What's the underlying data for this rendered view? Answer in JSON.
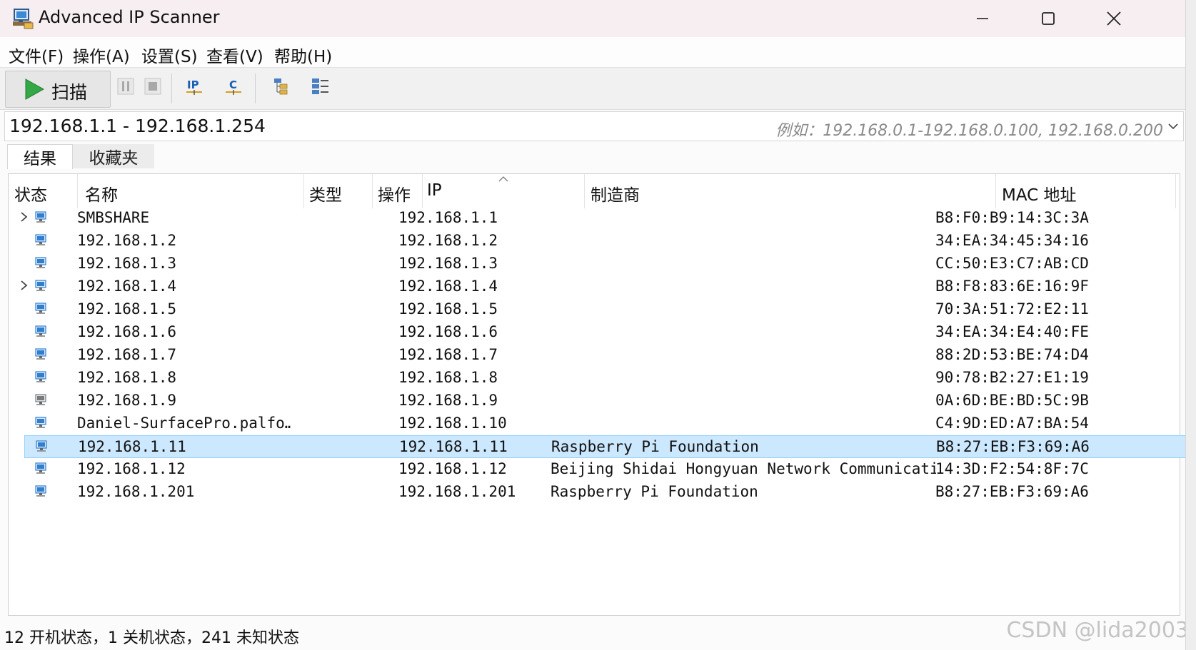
{
  "window": {
    "title": "Advanced IP Scanner",
    "minimize_label": "minimize",
    "maximize_label": "maximize",
    "close_label": "close"
  },
  "menu": [
    "文件(F)",
    "操作(A)",
    "设置(S)",
    "查看(V)",
    "帮助(H)"
  ],
  "toolbar": {
    "scan_label": "扫描",
    "icons": [
      "pause-icon",
      "stop-icon",
      "ip-icon",
      "c-class-icon",
      "expand-all-icon",
      "collapse-all-icon"
    ]
  },
  "range": {
    "value": "192.168.1.1 - 192.168.1.254",
    "placeholder": "例如：192.168.0.1-192.168.0.100, 192.168.0.200"
  },
  "tabs": [
    {
      "label": "结果",
      "active": true
    },
    {
      "label": "收藏夹",
      "active": false
    }
  ],
  "columns": {
    "status": "状态",
    "name": "名称",
    "type": "类型",
    "ops": "操作",
    "ip": "IP",
    "vendor": "制造商",
    "mac": "MAC 地址"
  },
  "rows": [
    {
      "name": "SMBSHARE",
      "ip": "192.168.1.1",
      "vendor": "",
      "mac": "B8:F0:B9:14:3C:3A",
      "expandable": true,
      "selected": false,
      "state": "on"
    },
    {
      "name": "192.168.1.2",
      "ip": "192.168.1.2",
      "vendor": "",
      "mac": "34:EA:34:45:34:16",
      "expandable": false,
      "selected": false,
      "state": "on"
    },
    {
      "name": "192.168.1.3",
      "ip": "192.168.1.3",
      "vendor": "",
      "mac": "CC:50:E3:C7:AB:CD",
      "expandable": false,
      "selected": false,
      "state": "on"
    },
    {
      "name": "192.168.1.4",
      "ip": "192.168.1.4",
      "vendor": "",
      "mac": "B8:F8:83:6E:16:9F",
      "expandable": true,
      "selected": false,
      "state": "on"
    },
    {
      "name": "192.168.1.5",
      "ip": "192.168.1.5",
      "vendor": "",
      "mac": "70:3A:51:72:E2:11",
      "expandable": false,
      "selected": false,
      "state": "on"
    },
    {
      "name": "192.168.1.6",
      "ip": "192.168.1.6",
      "vendor": "",
      "mac": "34:EA:34:E4:40:FE",
      "expandable": false,
      "selected": false,
      "state": "on"
    },
    {
      "name": "192.168.1.7",
      "ip": "192.168.1.7",
      "vendor": "",
      "mac": "88:2D:53:BE:74:D4",
      "expandable": false,
      "selected": false,
      "state": "on"
    },
    {
      "name": "192.168.1.8",
      "ip": "192.168.1.8",
      "vendor": "",
      "mac": "90:78:B2:27:E1:19",
      "expandable": false,
      "selected": false,
      "state": "on"
    },
    {
      "name": "192.168.1.9",
      "ip": "192.168.1.9",
      "vendor": "",
      "mac": "0A:6D:BE:BD:5C:9B",
      "expandable": false,
      "selected": false,
      "state": "off"
    },
    {
      "name": "Daniel-SurfacePro.palfo…",
      "ip": "192.168.1.10",
      "vendor": "",
      "mac": "C4:9D:ED:A7:BA:54",
      "expandable": false,
      "selected": false,
      "state": "on"
    },
    {
      "name": "192.168.1.11",
      "ip": "192.168.1.11",
      "vendor": "Raspberry Pi Foundation",
      "mac": "B8:27:EB:F3:69:A6",
      "expandable": false,
      "selected": true,
      "state": "on"
    },
    {
      "name": "192.168.1.12",
      "ip": "192.168.1.12",
      "vendor": "Beijing Shidai Hongyuan Network Communication…",
      "mac": "14:3D:F2:54:8F:7C",
      "expandable": false,
      "selected": false,
      "state": "on"
    },
    {
      "name": "192.168.1.201",
      "ip": "192.168.1.201",
      "vendor": "Raspberry Pi Foundation",
      "mac": "B8:27:EB:F3:69:A6",
      "expandable": false,
      "selected": false,
      "state": "on"
    }
  ],
  "status_bar": "12 开机状态，1 关机状态，241 未知状态",
  "watermark": "CSDN @lida2003",
  "colors": {
    "accent": "#0078d7",
    "selection": "#cce8ff",
    "scan_green": "#2ea043"
  }
}
